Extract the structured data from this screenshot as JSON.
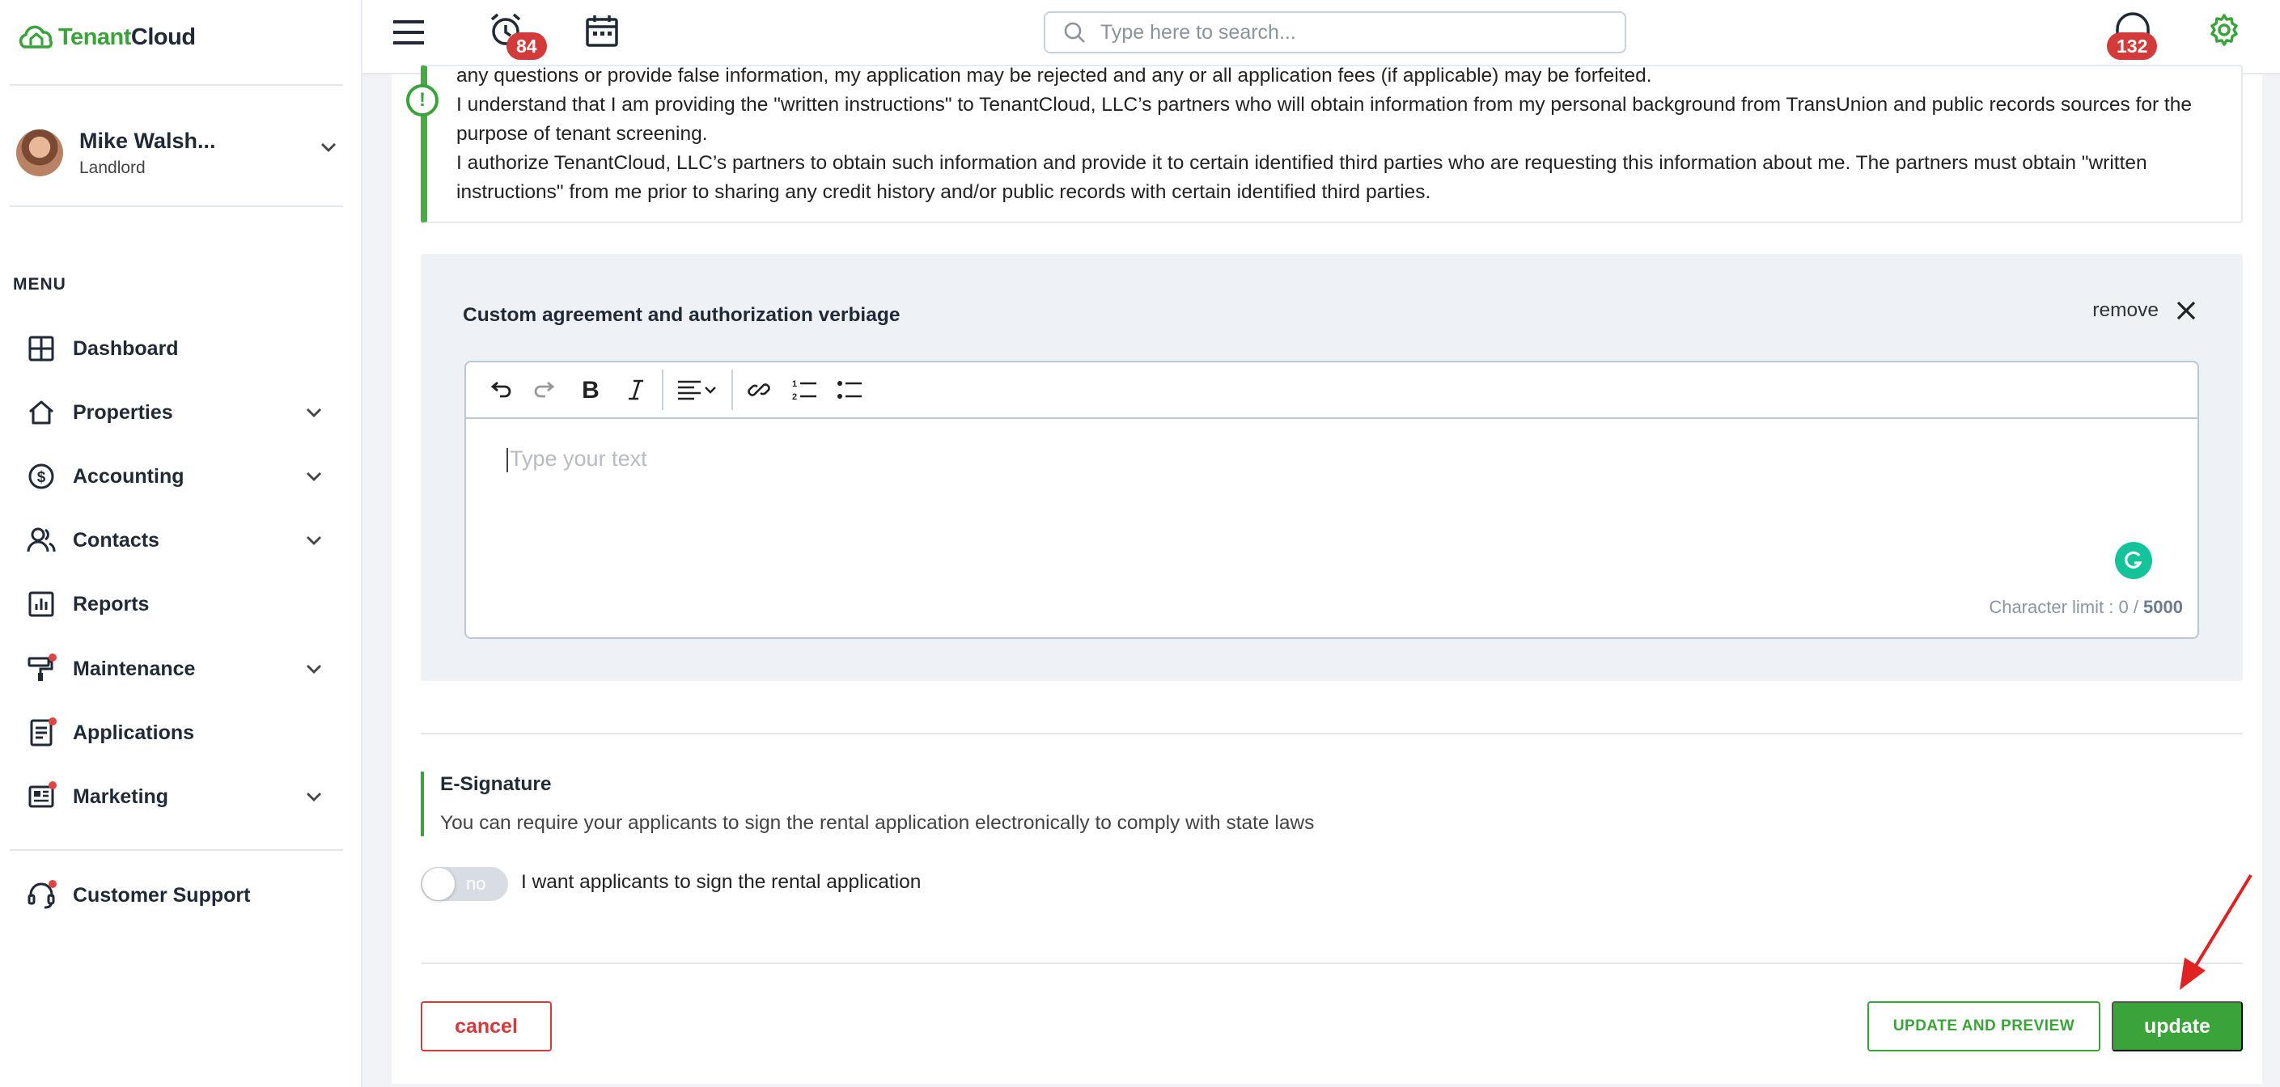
{
  "app": {
    "logo_prefix": "Tenant",
    "logo_suffix": "Cloud"
  },
  "user": {
    "name": "Mike Walsh...",
    "role": "Landlord"
  },
  "menu": {
    "heading": "MENU",
    "items": [
      {
        "label": "Dashboard",
        "icon": "dashboard-icon",
        "has_dot": false,
        "has_chevron": false
      },
      {
        "label": "Properties",
        "icon": "home-icon",
        "has_dot": false,
        "has_chevron": true
      },
      {
        "label": "Accounting",
        "icon": "dollar-icon",
        "has_dot": false,
        "has_chevron": true
      },
      {
        "label": "Contacts",
        "icon": "contacts-icon",
        "has_dot": false,
        "has_chevron": true
      },
      {
        "label": "Reports",
        "icon": "reports-icon",
        "has_dot": false,
        "has_chevron": false
      },
      {
        "label": "Maintenance",
        "icon": "paint-roller-icon",
        "has_dot": true,
        "has_chevron": true
      },
      {
        "label": "Applications",
        "icon": "document-icon",
        "has_dot": true,
        "has_chevron": false
      },
      {
        "label": "Marketing",
        "icon": "newspaper-icon",
        "has_dot": true,
        "has_chevron": true
      }
    ],
    "support": {
      "label": "Customer Support",
      "icon": "headset-icon",
      "has_dot": true
    }
  },
  "topbar": {
    "alarm_badge": "84",
    "search_placeholder": "Type here to search...",
    "support_badge": "132"
  },
  "notice": {
    "lines": [
      "any questions or provide false information, my application may be rejected and any or all application fees (if applicable) may be forfeited.",
      "I understand that I am providing the \"written instructions\" to TenantCloud, LLC’s partners who will obtain information from my personal background from TransUnion and public records sources for the purpose of tenant screening.",
      "I authorize TenantCloud, LLC’s partners to obtain such information and provide it to certain identified third parties who are requesting this information about me. The partners must obtain \"written instructions\" from me prior to sharing any credit history and/or public records with certain identified third parties."
    ]
  },
  "custom_agreement": {
    "title": "Custom agreement and authorization verbiage",
    "remove_label": "remove",
    "editor_placeholder": "Type your text",
    "char_limit_label": "Character limit : 0 / ",
    "char_limit_max": "5000"
  },
  "esignature": {
    "title": "E-Signature",
    "description": "You can require your applicants to sign the rental application electronically to comply with state laws",
    "toggle_value": "no",
    "toggle_label": "I want applicants to sign the rental application"
  },
  "actions": {
    "cancel": "cancel",
    "update_preview": "UPDATE AND PREVIEW",
    "update": "update"
  },
  "colors": {
    "brand_green": "#3aa43a",
    "danger_red": "#d33b3b",
    "grammarly_teal": "#15c39a"
  }
}
